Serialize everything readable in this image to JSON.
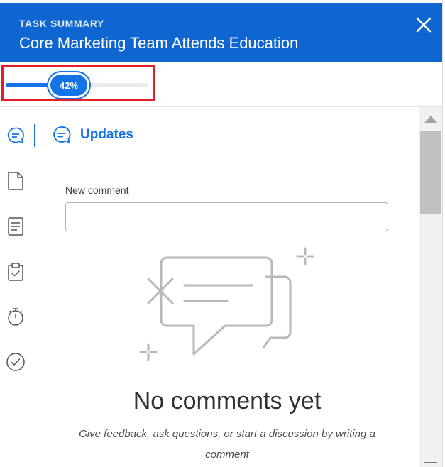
{
  "header": {
    "label": "TASK SUMMARY",
    "title": "Core Marketing Team Attends Education",
    "close_icon": "close-icon"
  },
  "progress": {
    "percent": 42,
    "label": "42%"
  },
  "sidebar": {
    "items": [
      {
        "name": "updates",
        "icon": "comment-icon",
        "active": true
      },
      {
        "name": "documents",
        "icon": "document-icon"
      },
      {
        "name": "details",
        "icon": "form-icon"
      },
      {
        "name": "approvals",
        "icon": "clipboard-check-icon"
      },
      {
        "name": "time",
        "icon": "stopwatch-icon"
      },
      {
        "name": "complete",
        "icon": "check-circle-icon"
      }
    ]
  },
  "updates": {
    "title": "Updates",
    "new_comment_label": "New comment",
    "new_comment_value": "",
    "new_comment_placeholder": "",
    "empty_title": "No comments yet",
    "empty_description": "Give feedback, ask questions, or start a discussion by writing a comment"
  },
  "colors": {
    "header_bg": "#0f66d0",
    "accent": "#1473e6",
    "highlight_border": "#e3202a"
  }
}
